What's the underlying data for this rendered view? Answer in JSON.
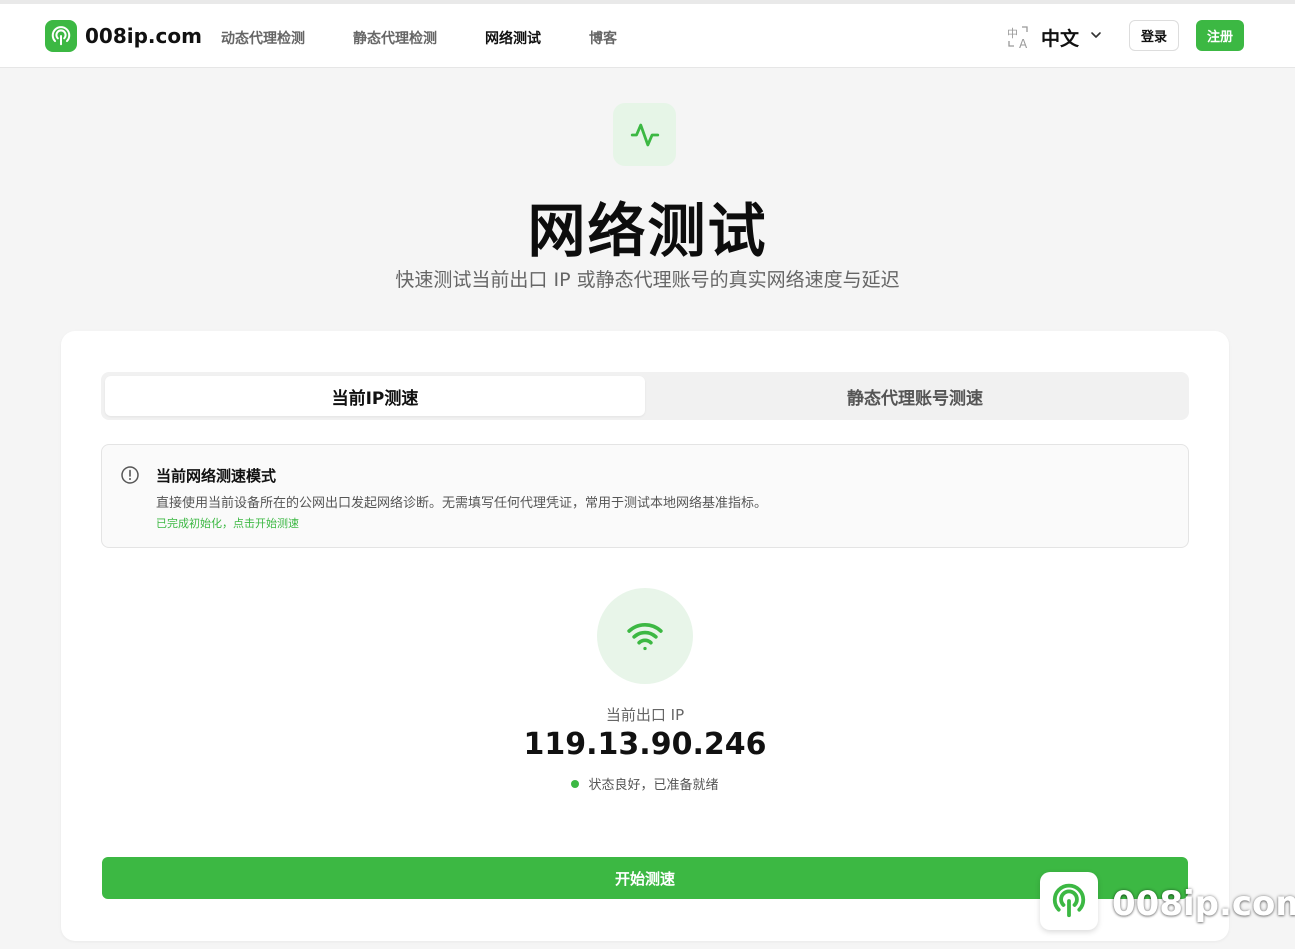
{
  "brand": {
    "name": "008ip.com"
  },
  "nav": {
    "items": [
      {
        "label": "动态代理检测"
      },
      {
        "label": "静态代理检测"
      },
      {
        "label": "网络测试"
      },
      {
        "label": "博客"
      }
    ],
    "active": "网络测试"
  },
  "header": {
    "language": "中文",
    "login_label": "登录",
    "register_label": "注册"
  },
  "hero": {
    "icon": "activity-pulse-icon",
    "title": "网络测试",
    "subtitle": "快速测试当前出口 IP 或静态代理账号的真实网络速度与延迟"
  },
  "tabs": [
    {
      "label": "当前IP测速",
      "active": true
    },
    {
      "label": "静态代理账号测速",
      "active": false
    }
  ],
  "info": {
    "title": "当前网络测速模式",
    "description": "直接使用当前设备所在的公网出口发起网络诊断。无需填写任何代理凭证，常用于测试本地网络基准指标。",
    "status": "已完成初始化，点击开始测速"
  },
  "ip_panel": {
    "icon": "wifi-icon",
    "label": "当前出口 IP",
    "ip": "119.13.90.246",
    "status": "状态良好，已准备就绪"
  },
  "actions": {
    "start_label": "开始测速"
  },
  "watermark": {
    "text": "008ip.com"
  },
  "colors": {
    "accent": "#3cb843",
    "background": "#f5f5f5"
  }
}
